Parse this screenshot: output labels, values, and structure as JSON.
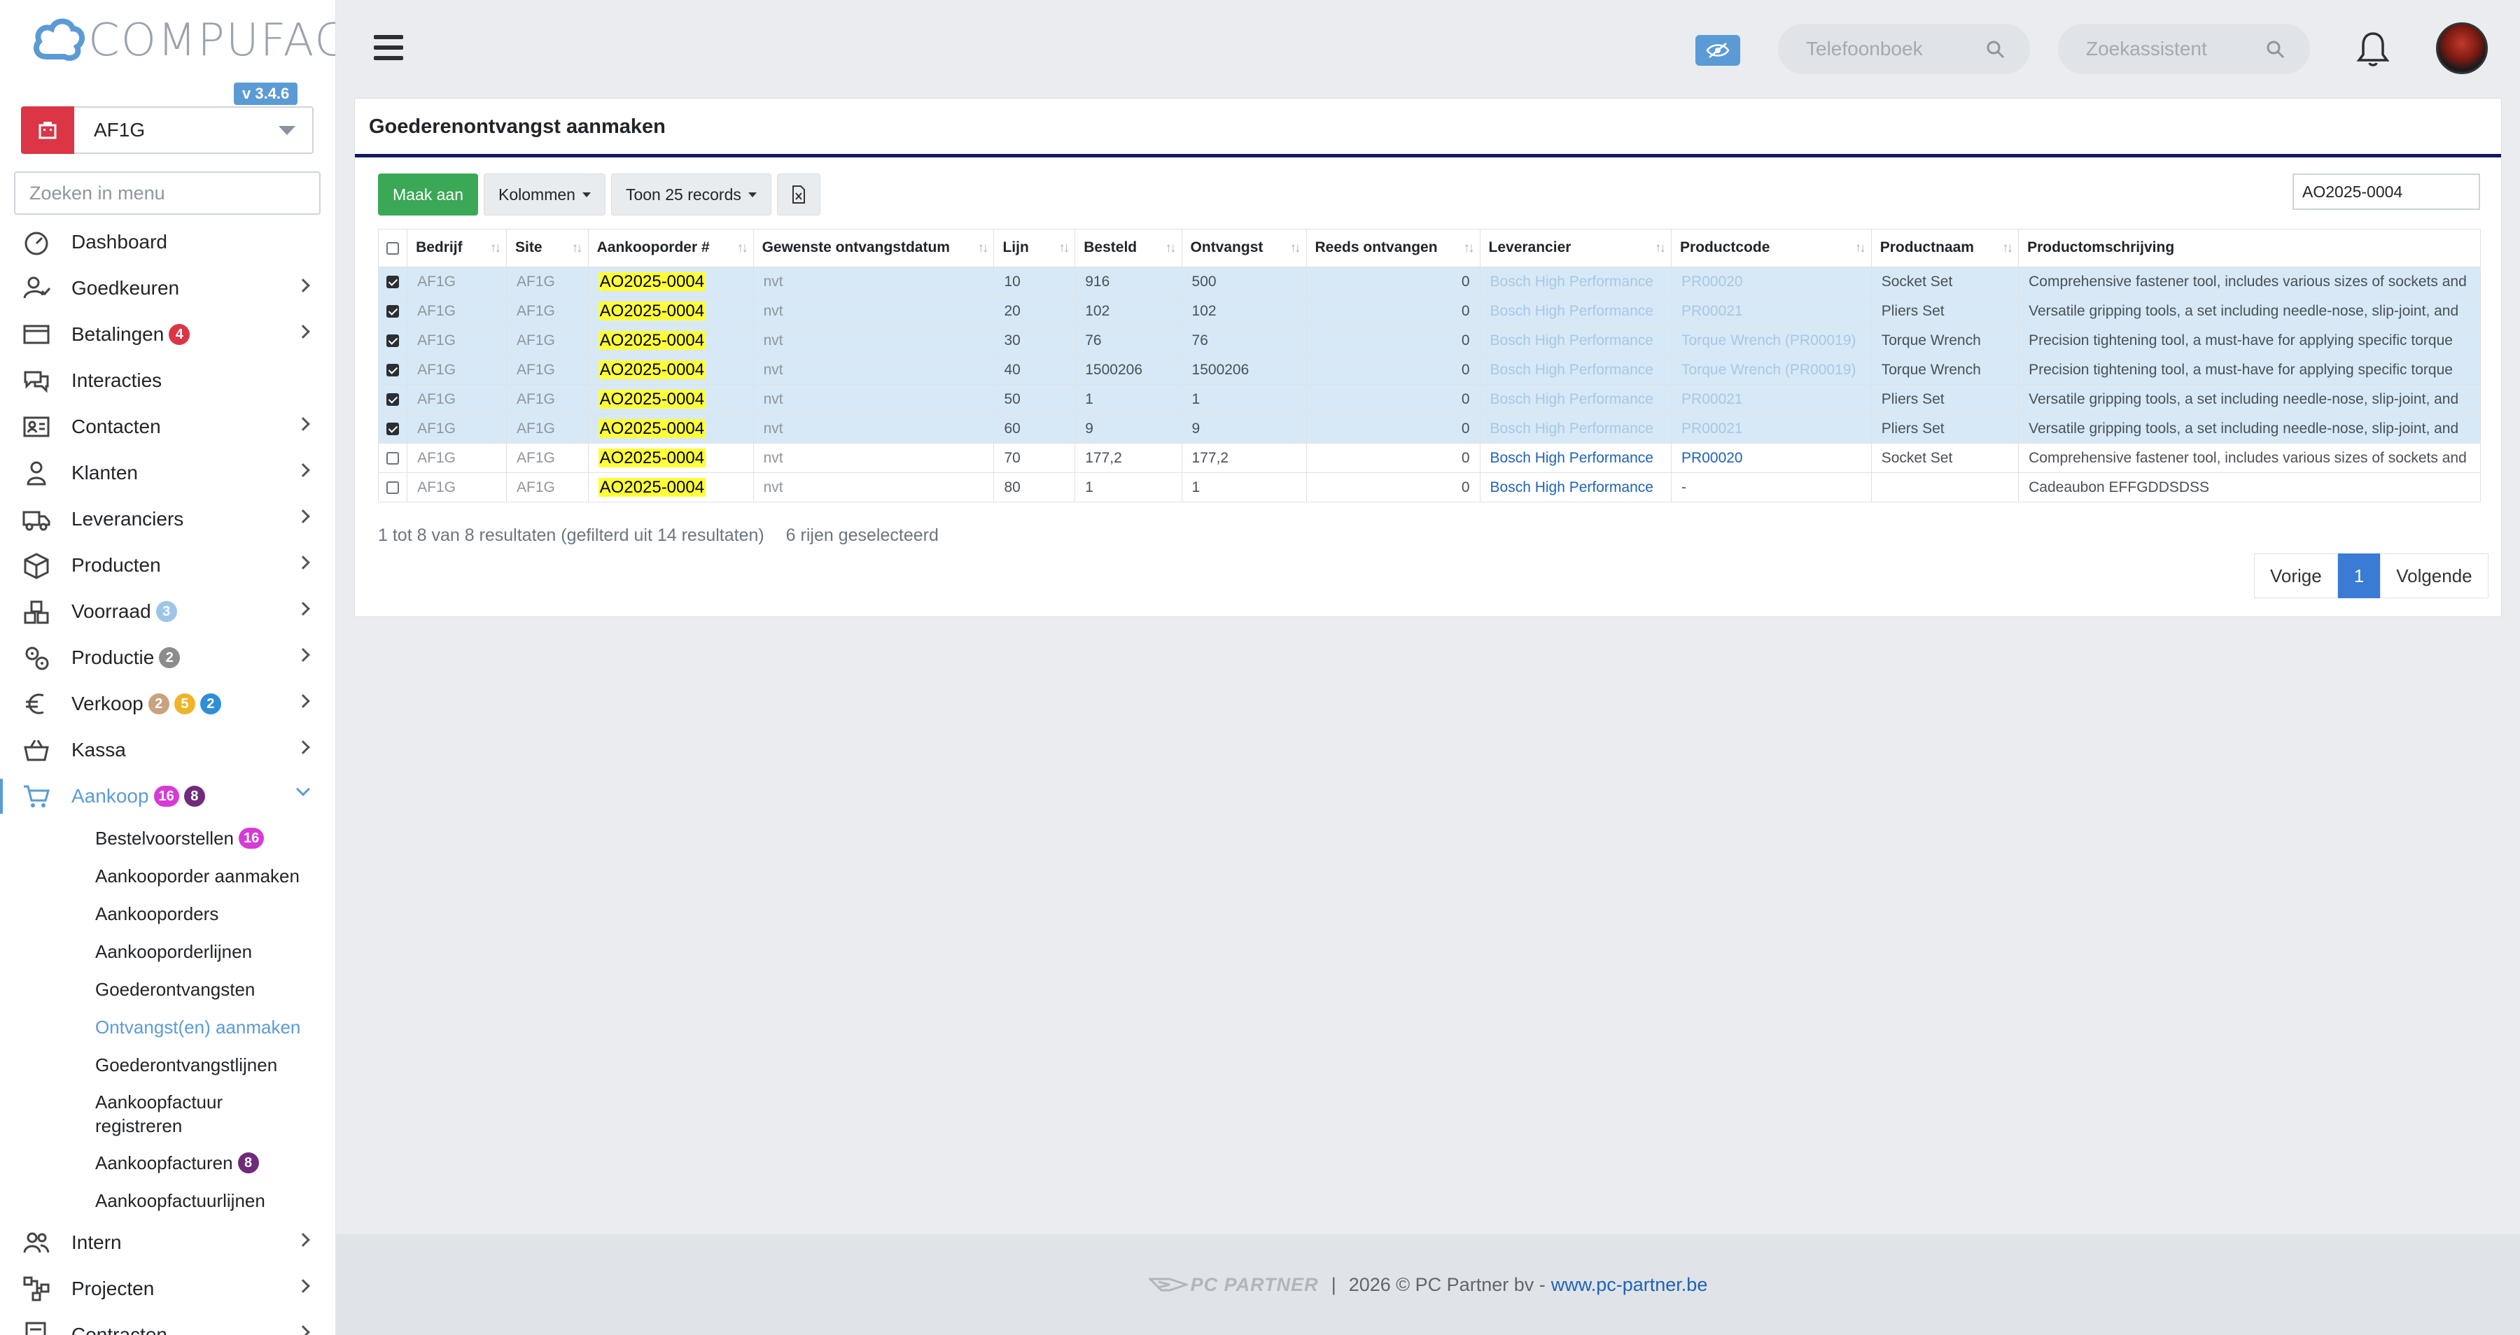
{
  "app": {
    "brand": "COMPUFACT",
    "version": "v 3.4.6",
    "company": "AF1G",
    "menu_search_placeholder": "Zoeken in menu"
  },
  "topbar": {
    "phonebook_placeholder": "Telefoonboek",
    "assistant_placeholder": "Zoekassistent"
  },
  "nav": [
    {
      "label": "Dashboard",
      "icon": "dashboard-icon"
    },
    {
      "label": "Goedkeuren",
      "icon": "user-check-icon"
    },
    {
      "label": "Betalingen",
      "icon": "credit-card-icon",
      "badges": [
        "4"
      ]
    },
    {
      "label": "Interacties",
      "icon": "chat-icon"
    },
    {
      "label": "Contacten",
      "icon": "contact-card-icon"
    },
    {
      "label": "Klanten",
      "icon": "customer-icon"
    },
    {
      "label": "Leveranciers",
      "icon": "truck-icon"
    },
    {
      "label": "Producten",
      "icon": "box-icon"
    },
    {
      "label": "Voorraad",
      "icon": "boxes-icon",
      "badges": [
        "3"
      ]
    },
    {
      "label": "Productie",
      "icon": "gears-icon",
      "badges": [
        "2"
      ]
    },
    {
      "label": "Verkoop",
      "icon": "euro-icon",
      "badges": [
        "2",
        "5",
        "2"
      ]
    },
    {
      "label": "Kassa",
      "icon": "basket-icon"
    },
    {
      "label": "Aankoop",
      "icon": "cart-icon",
      "badges": [
        "16",
        "8"
      ]
    },
    {
      "label": "Intern",
      "icon": "users-icon"
    },
    {
      "label": "Projecten",
      "icon": "project-icon"
    },
    {
      "label": "Contracten",
      "icon": "contract-icon"
    }
  ],
  "subnav": [
    {
      "label": "Bestelvoorstellen",
      "badge": "16"
    },
    {
      "label": "Aankooporder aanmaken"
    },
    {
      "label": "Aankooporders"
    },
    {
      "label": "Aankooporderlijnen"
    },
    {
      "label": "Goederontvangsten"
    },
    {
      "label": "Ontvangst(en) aanmaken"
    },
    {
      "label": "Goederontvangstlijnen"
    },
    {
      "label": "Aankoopfactuur registreren"
    },
    {
      "label": "Aankoopfacturen",
      "badge": "8"
    },
    {
      "label": "Aankoopfactuurlijnen"
    }
  ],
  "colors": {
    "accent": "#5b9bd5",
    "header_rule": "#151a5e",
    "create_button": "#3aa854",
    "badge_red": "#dc3545",
    "badge_blue_light": "#9ec5e8",
    "badge_gray": "#8c8c8c",
    "badge_tan": "#c9a27e",
    "badge_yellow": "#f0b429",
    "badge_blue": "#2f8fd6",
    "badge_pink": "#d63bd6",
    "badge_purple": "#6f2c7a"
  },
  "card": {
    "title": "Goederenontvangst aanmaken",
    "create_button": "Maak aan",
    "columns_button": "Kolommen",
    "records_button": "Toon 25 records",
    "filter_value": "AO2025-0004",
    "columns": [
      "Bedrijf",
      "Site",
      "Aankooporder #",
      "Gewenste ontvangstdatum",
      "Lijn",
      "Besteld",
      "Ontvangst",
      "Reeds ontvangen",
      "Leverancier",
      "Productcode",
      "Productnaam",
      "Productomschrijving"
    ],
    "rows": [
      {
        "selected": true,
        "bedrijf": "AF1G",
        "site": "AF1G",
        "order": "AO2025-0004",
        "datum": "nvt",
        "lijn": "10",
        "besteld": "916",
        "ontvangst": "500",
        "reeds": "0",
        "leverancier": "Bosch High Performance",
        "code": "PR00020",
        "naam": "Socket Set",
        "omschrijving": "Comprehensive fastener tool, includes various sizes of sockets and"
      },
      {
        "selected": true,
        "bedrijf": "AF1G",
        "site": "AF1G",
        "order": "AO2025-0004",
        "datum": "nvt",
        "lijn": "20",
        "besteld": "102",
        "ontvangst": "102",
        "reeds": "0",
        "leverancier": "Bosch High Performance",
        "code": "PR00021",
        "naam": "Pliers Set",
        "omschrijving": "Versatile gripping tools, a set including needle-nose, slip-joint, and"
      },
      {
        "selected": true,
        "bedrijf": "AF1G",
        "site": "AF1G",
        "order": "AO2025-0004",
        "datum": "nvt",
        "lijn": "30",
        "besteld": "76",
        "ontvangst": "76",
        "reeds": "0",
        "leverancier": "Bosch High Performance",
        "code": "Torque Wrench (PR00019)",
        "naam": "Torque Wrench",
        "omschrijving": "Precision tightening tool, a must-have for applying specific torque"
      },
      {
        "selected": true,
        "bedrijf": "AF1G",
        "site": "AF1G",
        "order": "AO2025-0004",
        "datum": "nvt",
        "lijn": "40",
        "besteld": "1500206",
        "ontvangst": "1500206",
        "reeds": "0",
        "leverancier": "Bosch High Performance",
        "code": "Torque Wrench (PR00019)",
        "naam": "Torque Wrench",
        "omschrijving": "Precision tightening tool, a must-have for applying specific torque"
      },
      {
        "selected": true,
        "bedrijf": "AF1G",
        "site": "AF1G",
        "order": "AO2025-0004",
        "datum": "nvt",
        "lijn": "50",
        "besteld": "1",
        "ontvangst": "1",
        "reeds": "0",
        "leverancier": "Bosch High Performance",
        "code": "PR00021",
        "naam": "Pliers Set",
        "omschrijving": "Versatile gripping tools, a set including needle-nose, slip-joint, and"
      },
      {
        "selected": true,
        "bedrijf": "AF1G",
        "site": "AF1G",
        "order": "AO2025-0004",
        "datum": "nvt",
        "lijn": "60",
        "besteld": "9",
        "ontvangst": "9",
        "reeds": "0",
        "leverancier": "Bosch High Performance",
        "code": "PR00021",
        "naam": "Pliers Set",
        "omschrijving": "Versatile gripping tools, a set including needle-nose, slip-joint, and"
      },
      {
        "selected": false,
        "bedrijf": "AF1G",
        "site": "AF1G",
        "order": "AO2025-0004",
        "datum": "nvt",
        "lijn": "70",
        "besteld": "177,2",
        "ontvangst": "177,2",
        "reeds": "0",
        "leverancier": "Bosch High Performance",
        "code": "PR00020",
        "naam": "Socket Set",
        "omschrijving": "Comprehensive fastener tool, includes various sizes of sockets and"
      },
      {
        "selected": false,
        "bedrijf": "AF1G",
        "site": "AF1G",
        "order": "AO2025-0004",
        "datum": "nvt",
        "lijn": "80",
        "besteld": "1",
        "ontvangst": "1",
        "reeds": "0",
        "leverancier": "Bosch High Performance",
        "code": "-",
        "naam": "",
        "omschrijving": "Cadeaubon EFFGDDSDSS"
      }
    ],
    "info_results": "1 tot 8 van 8 resultaten (gefilterd uit 14 resultaten)",
    "info_selected": "6 rijen geselecteerd",
    "pager_prev": "Vorige",
    "pager_page": "1",
    "pager_next": "Volgende"
  },
  "footer": {
    "brand": "PC PARTNER",
    "separator": "|",
    "copyright": "2026 © PC Partner bv -",
    "link": "www.pc-partner.be"
  }
}
